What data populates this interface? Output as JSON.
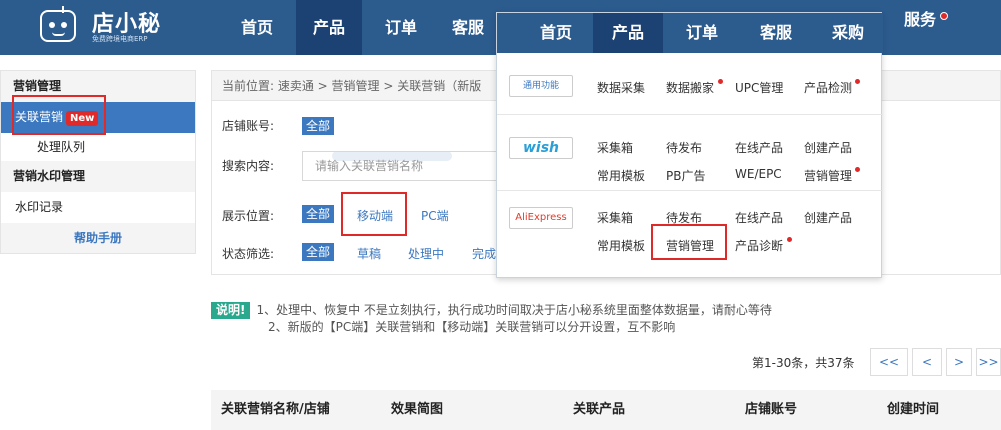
{
  "app": {
    "logo_name": "店小秘",
    "logo_sub": "免费跨境电商ERP"
  },
  "nav": {
    "items": [
      "首页",
      "产品",
      "订单",
      "客服"
    ],
    "active": "产品"
  },
  "sidebar": {
    "section1": "营销管理",
    "item_related": "关联营销",
    "badge_new": "New",
    "item_queue": "处理队列",
    "section2": "营销水印管理",
    "item_watermark": "水印记录",
    "help": "帮助手册"
  },
  "breadcrumb": "当前位置:  速卖通 > 营销管理 > 关联营销（新版",
  "filters": {
    "shop_label": "店铺账号:",
    "all": "全部",
    "search_label": "搜索内容:",
    "search_placeholder": "请输入关联营销名称",
    "display_label": "展示位置:",
    "display_mobile": "移动端",
    "display_pc": "PC端",
    "status_label": "状态筛选:",
    "status_draft": "草稿",
    "status_processing": "处理中",
    "status_done": "完成"
  },
  "notice": {
    "tag": "说明!",
    "line1": "1、处理中、恢复中 不是立刻执行，执行成功时间取决于店小秘系统里面整体数据量，请耐心等待",
    "line2": "2、新版的【PC端】关联营销和【移动端】关联营销可以分开设置，互不影响"
  },
  "pager": {
    "info": "第1-30条，共37条",
    "first": "<<",
    "prev": "<",
    "next": ">",
    "last": ">>"
  },
  "table": {
    "headers": [
      "关联营销名称/店铺",
      "效果简图",
      "关联产品",
      "店铺账号",
      "创建时间"
    ]
  },
  "dropdown": {
    "nav": [
      "首页",
      "产品",
      "订单",
      "客服",
      "采购",
      "服务"
    ],
    "active": "产品",
    "general": {
      "logo": "通用功能",
      "links": [
        "数据采集",
        "数据搬家",
        "UPC管理",
        "产品检测"
      ]
    },
    "wish": {
      "logo": "wish",
      "row1": [
        "采集箱",
        "待发布",
        "在线产品",
        "创建产品"
      ],
      "row2": [
        "常用模板",
        "PB广告",
        "WE/EPC",
        "营销管理"
      ]
    },
    "aliexpress": {
      "logo": "AliExpress",
      "row1": [
        "采集箱",
        "待发布",
        "在线产品",
        "创建产品"
      ],
      "row2": [
        "常用模板",
        "营销管理",
        "产品诊断"
      ]
    }
  },
  "colors": {
    "header_bg": "#2c5b8e",
    "header_active": "#1b4272",
    "accent_blue": "#3c78c0",
    "highlight_red": "#e02a2a",
    "notice_green": "#2aa88e"
  }
}
